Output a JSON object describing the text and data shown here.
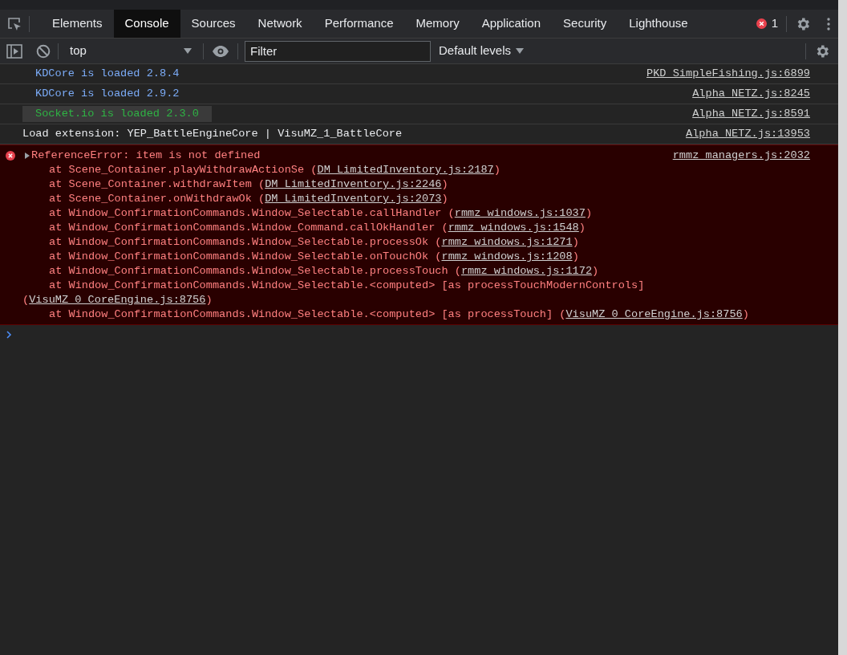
{
  "tabs": [
    {
      "label": "Elements",
      "selected": false
    },
    {
      "label": "Console",
      "selected": true
    },
    {
      "label": "Sources",
      "selected": false
    },
    {
      "label": "Network",
      "selected": false
    },
    {
      "label": "Performance",
      "selected": false
    },
    {
      "label": "Memory",
      "selected": false
    },
    {
      "label": "Application",
      "selected": false
    },
    {
      "label": "Security",
      "selected": false
    },
    {
      "label": "Lighthouse",
      "selected": false
    }
  ],
  "error_count": "1",
  "toolbar": {
    "context": "top",
    "filter_placeholder": "Filter",
    "levels": "Default levels"
  },
  "messages": [
    {
      "kind": "log",
      "text": "KDCore is loaded 2.8.4",
      "color": "#7cacf8",
      "highlighted": false,
      "source": "PKD_SimpleFishing.js:6899"
    },
    {
      "kind": "log",
      "text": "KDCore is loaded 2.9.2",
      "color": "#7cacf8",
      "highlighted": false,
      "source": "Alpha_NETZ.js:8245"
    },
    {
      "kind": "log",
      "text": "Socket.io is loaded 2.3.0",
      "color": "#2fb344",
      "highlighted": true,
      "source": "Alpha_NETZ.js:8591"
    },
    {
      "kind": "plain",
      "text": "Load extension: YEP_BattleEngineCore | VisuMZ_1_BattleCore",
      "source": "Alpha_NETZ.js:13953"
    },
    {
      "kind": "error",
      "text": "ReferenceError: item is not defined",
      "source": "rmmz_managers.js:2032",
      "stack": [
        {
          "text": "at Scene_Container.playWithdrawActionSe (",
          "link": "DM_LimitedInventory.js:2187",
          "suffix": ")"
        },
        {
          "text": "at Scene_Container.withdrawItem (",
          "link": "DM_LimitedInventory.js:2246",
          "suffix": ")"
        },
        {
          "text": "at Scene_Container.onWithdrawOk (",
          "link": "DM_LimitedInventory.js:2073",
          "suffix": ")"
        },
        {
          "text": "at Window_ConfirmationCommands.Window_Selectable.callHandler (",
          "link": "rmmz_windows.js:1037",
          "suffix": ")"
        },
        {
          "text": "at Window_ConfirmationCommands.Window_Command.callOkHandler (",
          "link": "rmmz_windows.js:1548",
          "suffix": ")"
        },
        {
          "text": "at Window_ConfirmationCommands.Window_Selectable.processOk (",
          "link": "rmmz_windows.js:1271",
          "suffix": ")"
        },
        {
          "text": "at Window_ConfirmationCommands.Window_Selectable.onTouchOk (",
          "link": "rmmz_windows.js:1208",
          "suffix": ")"
        },
        {
          "text": "at Window_ConfirmationCommands.Window_Selectable.processTouch (",
          "link": "rmmz_windows.js:1172",
          "suffix": ")"
        },
        {
          "text": "at Window_ConfirmationCommands.Window_Selectable.<computed> [as processTouchModernControls] (",
          "link": "VisuMZ_0_CoreEngine.js:8756",
          "suffix": ")"
        },
        {
          "text": "at Window_ConfirmationCommands.Window_Selectable.<computed> [as processTouch] (",
          "link": "VisuMZ_0_CoreEngine.js:8756",
          "suffix": ")"
        }
      ]
    }
  ]
}
